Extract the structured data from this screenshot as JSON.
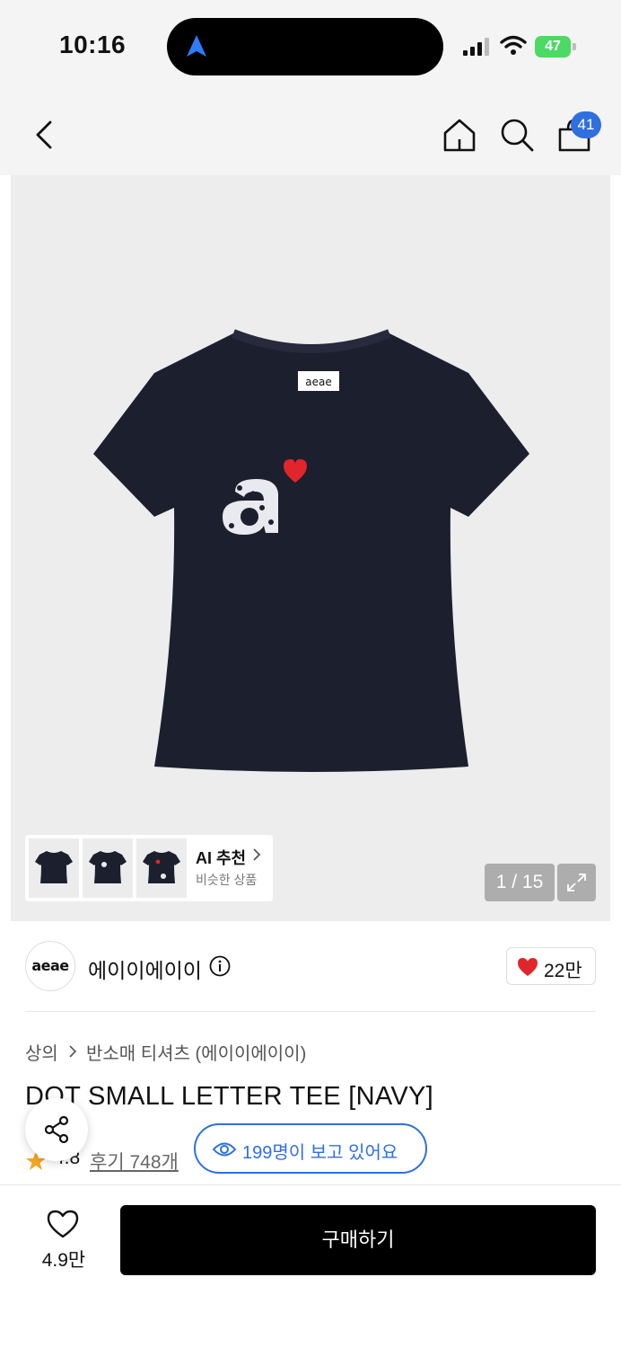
{
  "status_bar": {
    "time": "10:16",
    "battery": "47"
  },
  "nav": {
    "cart_count": "41"
  },
  "gallery": {
    "ai_title": "AI 추천",
    "ai_subtitle": "비슷한 상품",
    "counter": "1 / 15"
  },
  "brand": {
    "logo_text": "aeae",
    "name": "에이이에이이",
    "like_count": "22만"
  },
  "product": {
    "breadcrumb": [
      "상의",
      "반소매 티셔츠 (에이이에이이)"
    ],
    "title": "DOT SMALL LETTER TEE [NAVY]",
    "rating": "4.8",
    "reviews": "후기 748개",
    "viewers": "199명이 보고 있어요"
  },
  "bottom_bar": {
    "wish_count": "4.9만",
    "buy_label": "구매하기"
  },
  "colors": {
    "accent": "#2f6fe0",
    "shirt": "#1c1f2e",
    "heart": "#e0262c",
    "star": "#f5a623"
  }
}
